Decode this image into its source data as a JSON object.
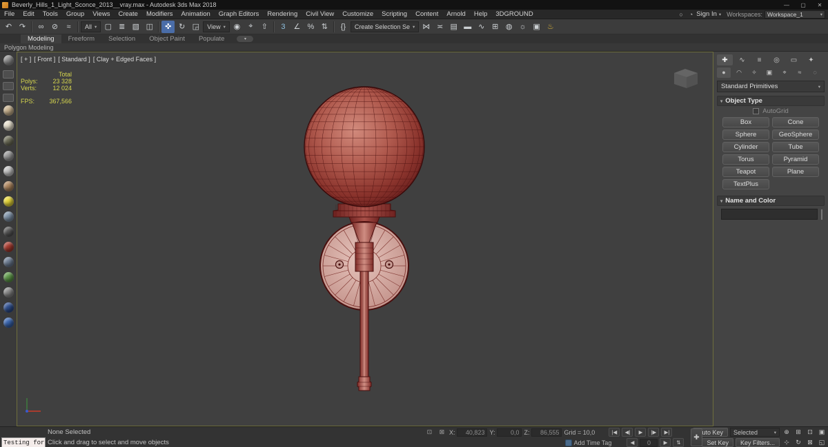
{
  "ui": {
    "caret": "▾",
    "minimize": "—",
    "restore": "▢",
    "close": "✕",
    "search": "○",
    "user": "◔",
    "chevron_right": "▸"
  },
  "title_bar": {
    "title": "Beverly_Hills_1_Light_Sconce_2013__vray.max - Autodesk 3ds Max 2018"
  },
  "menu_bar": {
    "items": [
      "File",
      "Edit",
      "Tools",
      "Group",
      "Views",
      "Create",
      "Modifiers",
      "Animation",
      "Graph Editors",
      "Rendering",
      "Civil View",
      "Customize",
      "Scripting",
      "Content",
      "Arnold",
      "Help",
      "3DGROUND"
    ],
    "sign_in": "Sign In",
    "workspaces_label": "Workspaces:",
    "workspace": "Workspace_1"
  },
  "toolbar": {
    "accent_gold": "#d8b23a",
    "accent_blue": "#8fc0e0",
    "items": [
      {
        "name": "undo",
        "glyph": "↶"
      },
      {
        "name": "redo",
        "glyph": "↷"
      },
      {
        "name": "select-and-link",
        "glyph": "∞"
      },
      {
        "name": "unlink-selection",
        "glyph": "⊘"
      },
      {
        "name": "bind-to-space-warp",
        "glyph": "≈"
      },
      {
        "name": "selection-filter",
        "label": "All"
      },
      {
        "name": "select-object",
        "glyph": "▢"
      },
      {
        "name": "select-by-name",
        "glyph": "≣"
      },
      {
        "name": "selection-region",
        "glyph": "▧"
      },
      {
        "name": "window-crossing",
        "glyph": "◫"
      },
      {
        "name": "select-and-move",
        "glyph": "✜",
        "active": true
      },
      {
        "name": "select-and-rotate",
        "glyph": "↻"
      },
      {
        "name": "select-and-scale",
        "glyph": "◲"
      },
      {
        "name": "reference-coordinate-system",
        "label": "View"
      },
      {
        "name": "use-pivot-point-center",
        "glyph": "◉"
      },
      {
        "name": "select-and-manipulate",
        "glyph": "⌖"
      },
      {
        "name": "keyboard-shortcut-override",
        "glyph": "⇧"
      },
      {
        "name": "snaps-toggle",
        "glyph": "3"
      },
      {
        "name": "angle-snap",
        "glyph": "∠"
      },
      {
        "name": "percent-snap",
        "glyph": "%"
      },
      {
        "name": "spinner-snap",
        "glyph": "⇅"
      },
      {
        "name": "edit-named-selection-sets",
        "glyph": "{}"
      },
      {
        "name": "named-selection-sets",
        "label": "Create Selection Se"
      },
      {
        "name": "mirror",
        "glyph": "⋈"
      },
      {
        "name": "align",
        "glyph": "≍"
      },
      {
        "name": "layer-explorer",
        "glyph": "▤"
      },
      {
        "name": "toggle-ribbon",
        "glyph": "▬"
      },
      {
        "name": "curve-editor",
        "glyph": "∿"
      },
      {
        "name": "schematic-view",
        "glyph": "⊞"
      },
      {
        "name": "material-editor",
        "glyph": "◍"
      },
      {
        "name": "render-setup",
        "glyph": "☼"
      },
      {
        "name": "rendered-frame-window",
        "glyph": "▣"
      },
      {
        "name": "render-production",
        "glyph": "♨"
      }
    ]
  },
  "ribbon": {
    "tabs": [
      "Modeling",
      "Freeform",
      "Selection",
      "Object Paint",
      "Populate"
    ],
    "subtab": "Polygon Modeling"
  },
  "left_rail": {
    "balls": [
      "#8f8f8f",
      "#c8b28e",
      "#e9e2cf",
      "#6f6f5a",
      "#9a9a9a",
      "#c4c4c4",
      "#b08860",
      "#e8d83a",
      "#7f93a8",
      "#585858",
      "#a83c30",
      "#6f7f95",
      "#5f9a4a",
      "#8a8a8a",
      "#2f4f8f",
      "#3a66b0"
    ]
  },
  "viewport": {
    "label_plus": "[ + ]",
    "label_view": "[ Front ]",
    "label_renderer": "[ Standard ]",
    "label_shading": "[ Clay + Edged Faces ]",
    "stats": {
      "total": "Total",
      "polys_label": "Polys:",
      "polys": "23 328",
      "verts_label": "Verts:",
      "verts": "12 024",
      "fps_label": "FPS:",
      "fps": "367,566"
    }
  },
  "command_panel": {
    "tabs": [
      {
        "name": "create",
        "glyph": "✚"
      },
      {
        "name": "modify",
        "glyph": "∿"
      },
      {
        "name": "hierarchy",
        "glyph": "≡"
      },
      {
        "name": "motion",
        "glyph": "◎"
      },
      {
        "name": "display",
        "glyph": "▭"
      },
      {
        "name": "utilities",
        "glyph": "✦"
      }
    ],
    "categories": [
      {
        "name": "geometry",
        "glyph": "●"
      },
      {
        "name": "shapes",
        "glyph": "◠"
      },
      {
        "name": "lights",
        "glyph": "✧"
      },
      {
        "name": "cameras",
        "glyph": "▣"
      },
      {
        "name": "helpers",
        "glyph": "⌖"
      },
      {
        "name": "space-warps",
        "glyph": "≈"
      },
      {
        "name": "systems",
        "glyph": "◌"
      }
    ],
    "primitive_dropdown": "Standard Primitives",
    "object_type_title": "Object Type",
    "autogrid": "AutoGrid",
    "buttons": [
      "Box",
      "Cone",
      "Sphere",
      "GeoSphere",
      "Cylinder",
      "Tube",
      "Torus",
      "Pyramid",
      "Teapot",
      "Plane",
      "TextPlus"
    ],
    "name_color_title": "Name and Color",
    "object_name_value": "",
    "swatch_color": "#9a9a9a"
  },
  "status_bar": {
    "listener": "Testing for",
    "selection_status": "None Selected",
    "prompt": "Click and drag to select and move objects",
    "isolate_glyph": "⊡",
    "lock_glyph": "⊠",
    "x_label": "X:",
    "x_value": "40,823",
    "y_label": "Y:",
    "y_value": "0,0",
    "z_label": "Z:",
    "z_value": "86,555",
    "grid": "Grid = 10,0",
    "time_tag": "Add Time Tag",
    "playback": [
      "|◀",
      "◀|",
      "▶",
      "|▶",
      "▶|"
    ],
    "frame_prev": "◀",
    "frame_value": "0",
    "frame_next": "▶",
    "frame_spin": "⇅",
    "set_keys_glyph": "✚",
    "auto_key": "Auto Key",
    "selected_set": "Selected",
    "set_key": "Set Key",
    "key_filters": "Key Filters...",
    "nav1": [
      "⊕",
      "⊞",
      "⊡",
      "▣"
    ],
    "nav2": [
      "⊹",
      "↻",
      "⊠",
      "◱"
    ]
  },
  "model": {
    "sphere": {
      "hi": "#d18a7c",
      "mid": "#b05a4e",
      "dark": "#8a332c",
      "edge": "#6b211f",
      "wire": "#4a0f0e",
      "outline": "#380b0b"
    },
    "collar": {
      "hi": "#a85048",
      "dark": "#6e2220",
      "wire": "#4a0f0e"
    },
    "plate": {
      "hi": "#e6c4bc",
      "edge": "#c4948c",
      "wire": "#7a2d28",
      "rim": "#4a0f0e",
      "screw": "#c79c94"
    },
    "stem": {
      "hi": "#cf8d82",
      "dark": "#7e2a26",
      "wire": "#4a0f0e"
    },
    "axis": {
      "x": "#cc3a28",
      "y": "#3f7a3f",
      "z": "#3a5acc"
    },
    "viewcube": {
      "top": "#9d9d9d",
      "front": "#818181",
      "side": "#6d6d6d"
    }
  }
}
